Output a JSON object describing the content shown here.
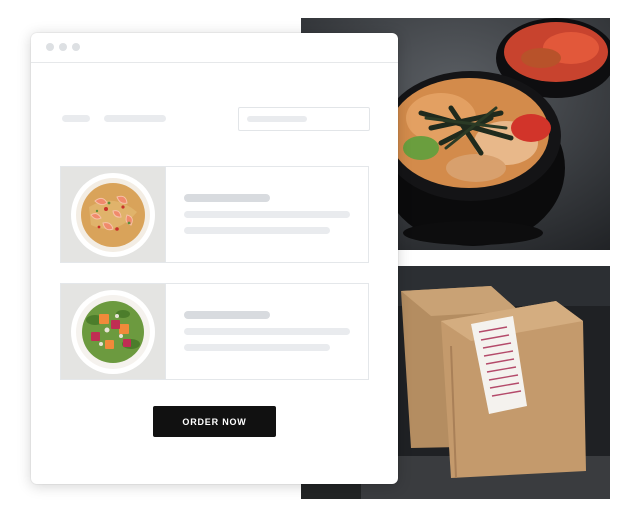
{
  "app": {
    "order_button_label": "ORDER NOW"
  },
  "images": {
    "top_photo": "noodle-bowls-photo",
    "bottom_photo": "takeout-paper-bags-photo",
    "card1_photo": "shrimp-pasta-plate",
    "card2_photo": "beet-salad-plate"
  },
  "colors": {
    "button_bg": "#111111",
    "skeleton": "#e9ebee",
    "border": "#e4e7ea"
  }
}
